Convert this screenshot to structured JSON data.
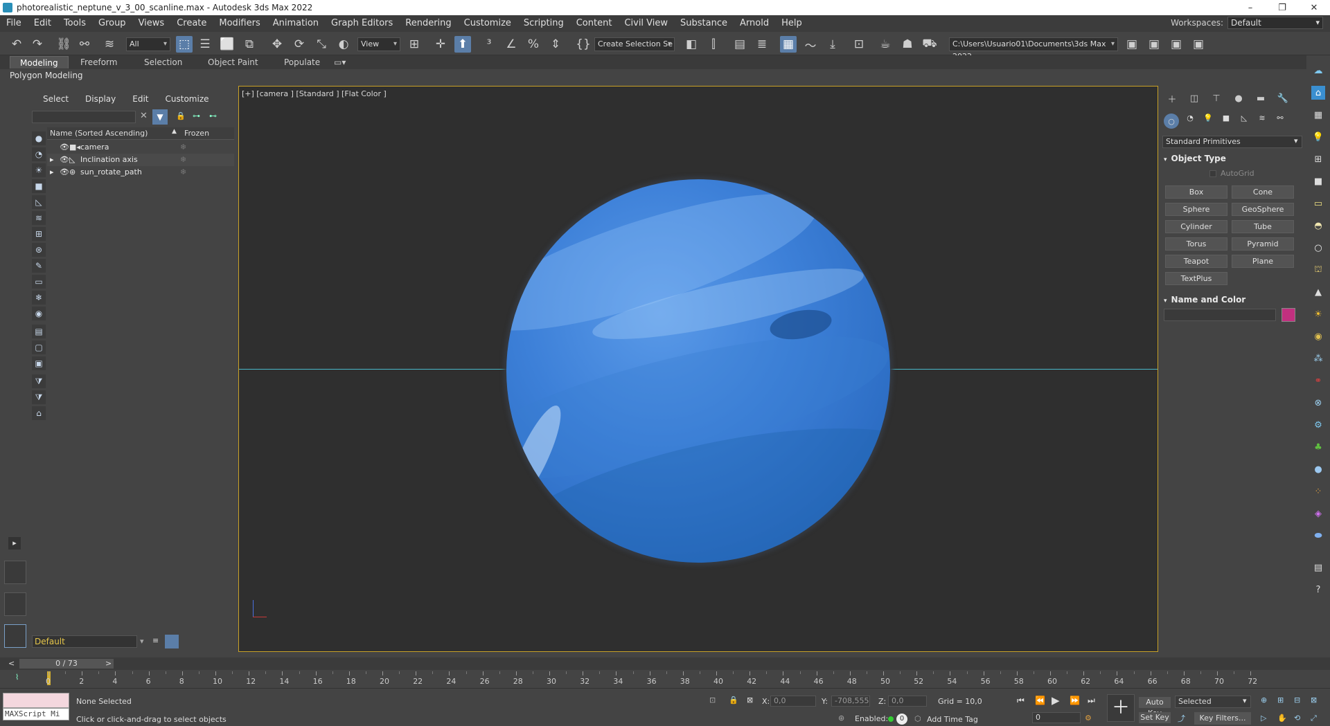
{
  "window": {
    "title": "photorealistic_neptune_v_3_00_scanline.max - Autodesk 3ds Max 2022"
  },
  "menu": [
    "File",
    "Edit",
    "Tools",
    "Group",
    "Views",
    "Create",
    "Modifiers",
    "Animation",
    "Graph Editors",
    "Rendering",
    "Customize",
    "Scripting",
    "Content",
    "Civil View",
    "Substance",
    "Arnold",
    "Help"
  ],
  "workspace": {
    "label": "Workspaces:",
    "value": "Default"
  },
  "toolbar": {
    "filter": "All",
    "refcoord": "View",
    "selection_set": "Create Selection Se",
    "project_path": "C:\\Users\\Usuario01\\Documents\\3ds Max 2022"
  },
  "ribbon": {
    "tabs": [
      "Modeling",
      "Freeform",
      "Selection",
      "Object Paint",
      "Populate"
    ],
    "panel": "Polygon Modeling"
  },
  "scene": {
    "tabs": [
      "Select",
      "Display",
      "Edit",
      "Customize"
    ],
    "col_name": "Name (Sorted Ascending)",
    "col_frozen": "Frozen",
    "sort_arrow": "▲",
    "rows": [
      {
        "name": "camera"
      },
      {
        "name": "Inclination axis"
      },
      {
        "name": "sun_rotate_path"
      }
    ],
    "layer": "Default"
  },
  "viewport": {
    "label": "[+] [camera ] [Standard ] [Flat Color ]"
  },
  "command": {
    "category": "Standard Primitives",
    "object_type": "Object Type",
    "autogrid": "AutoGrid",
    "buttons": [
      "Box",
      "Cone",
      "Sphere",
      "GeoSphere",
      "Cylinder",
      "Tube",
      "Torus",
      "Pyramid",
      "Teapot",
      "Plane",
      "TextPlus"
    ],
    "name_color": "Name and Color",
    "object_color": "#c1307f"
  },
  "time": {
    "slider": "0 / 73",
    "ticks": [
      "0",
      "2",
      "4",
      "6",
      "8",
      "10",
      "12",
      "14",
      "16",
      "18",
      "20",
      "22",
      "24",
      "26",
      "28",
      "30",
      "32",
      "34",
      "36",
      "38",
      "40",
      "42",
      "44",
      "46",
      "48",
      "50",
      "52",
      "54",
      "56",
      "58",
      "60",
      "62",
      "64",
      "66",
      "68",
      "70",
      "72"
    ]
  },
  "status": {
    "maxscript": "MAXScript Mi",
    "selection": "None Selected",
    "prompt": "Click or click-and-drag to select objects",
    "x_label": "X:",
    "x_val": "0,0",
    "y_label": "Y:",
    "y_val": "-708,555",
    "z_label": "Z:",
    "z_val": "0,0",
    "grid": "Grid = 10,0",
    "enabled": "Enabled:",
    "time_tag": "Add Time Tag",
    "auto_key": "Auto Key",
    "set_key": "Set Key",
    "key_mode": "Selected",
    "key_filters": "Key Filters...",
    "frame": "0",
    "enabled_count": "0"
  }
}
